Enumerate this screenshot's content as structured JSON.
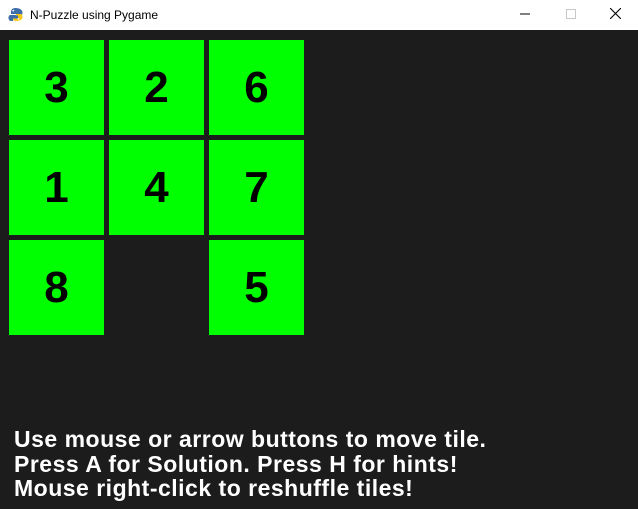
{
  "window": {
    "title": "N-Puzzle using Pygame",
    "app_icon": "pygame-snake-icon",
    "controls": [
      "minimize-icon",
      "maximize-icon",
      "close-icon"
    ]
  },
  "colors": {
    "background": "#1c1c1c",
    "tile": "#00ff00",
    "tile_text": "#000000",
    "instruction_text": "#ffffff"
  },
  "board": {
    "size": 3,
    "tiles": [
      [
        "3",
        "2",
        "6"
      ],
      [
        "1",
        "4",
        "7"
      ],
      [
        "8",
        "",
        "5"
      ]
    ]
  },
  "instructions": [
    "Use mouse or arrow buttons to move tile.",
    "Press A for Solution. Press H for hints!",
    "Mouse right-click to reshuffle tiles!"
  ]
}
